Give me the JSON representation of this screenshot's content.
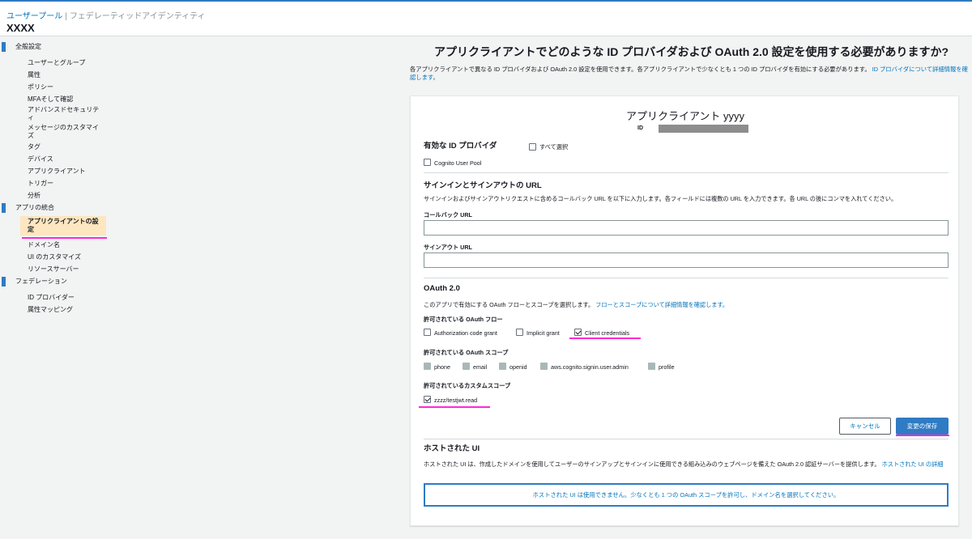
{
  "header": {
    "breadcrumb_active": "ユーザープール",
    "breadcrumb_inactive": "フェデレーティッドアイデンティティ",
    "pool_name": "XXXX"
  },
  "sidebar": {
    "sections": [
      {
        "label": "全般設定",
        "items": [
          "ユーザーとグループ",
          "属性",
          "ポリシー",
          "MFAそして確認",
          "アドバンスドセキュリティ",
          "メッセージのカスタマイズ",
          "タグ",
          "デバイス",
          "アプリクライアント",
          "トリガー",
          "分析"
        ]
      },
      {
        "label": "アプリの統合",
        "items": [
          "アプリクライアントの設定",
          "ドメイン名",
          "UI のカスタマイズ",
          "リソースサーバー"
        ]
      },
      {
        "label": "フェデレーション",
        "items": [
          "ID プロバイダー",
          "属性マッピング"
        ]
      }
    ],
    "active_item": "アプリクライアントの設定"
  },
  "page": {
    "title": "アプリクライアントでどのような ID プロバイダおよび OAuth 2.0 設定を使用する必要がありますか?",
    "intro": "各アプリクライアントで異なる ID プロバイダおよび OAuth 2.0 設定を使用できます。各アプリクライアントで少なくとも 1 つの ID プロバイダを有効にする必要があります。",
    "intro_link": "ID プロバイダについて詳細情報を確認します。"
  },
  "client": {
    "name": "アプリクライアント yyyy",
    "id_label": "ID"
  },
  "idp": {
    "heading": "有効な ID プロバイダ",
    "select_all": "すべて選択",
    "cognito": "Cognito User Pool"
  },
  "urls": {
    "heading": "サインインとサインアウトの URL",
    "desc": "サインインおよびサインアウトリクエストに含めるコールバック URL を以下に入力します。各フィールドには複数の URL を入力できます。各 URL の後にコンマを入れてください。",
    "callback_label": "コールバック URL",
    "callback_value": "",
    "signout_label": "サインアウト URL",
    "signout_value": ""
  },
  "oauth": {
    "heading": "OAuth 2.0",
    "desc": "このアプリで有効にする OAuth フローとスコープを選択します。",
    "desc_link": "フローとスコープについて詳細情報を確認します。",
    "flows_heading": "許可されている OAuth フロー",
    "flows": [
      {
        "label": "Authorization code grant",
        "checked": false
      },
      {
        "label": "Implicit grant",
        "checked": false
      },
      {
        "label": "Client credentials",
        "checked": true
      }
    ],
    "scopes_heading": "許可されている OAuth スコープ",
    "scopes": [
      "phone",
      "email",
      "openid",
      "aws.cognito.signin.user.admin",
      "profile"
    ],
    "custom_heading": "許可されているカスタムスコープ",
    "custom_scope": "zzzz/testjwt.read"
  },
  "buttons": {
    "cancel": "キャンセル",
    "save": "変更の保存"
  },
  "hosted": {
    "heading": "ホストされた UI",
    "desc": "ホストされた UI は、作成したドメインを使用してユーザーのサインアップとサインインに使用できる組み込みのウェブページを備えた OAuth 2.0 認証サーバーを提供します。",
    "desc_link": "ホストされた UI の詳細",
    "notice": "ホストされた UI は使用できません。少なくとも 1 つの OAuth スコープを許可し、ドメイン名を選択してください。"
  },
  "colors": {
    "accent": "#2f7bc4",
    "link": "#0073bb",
    "highlight": "#ff2ad4",
    "active_bg": "#fde6c0"
  }
}
